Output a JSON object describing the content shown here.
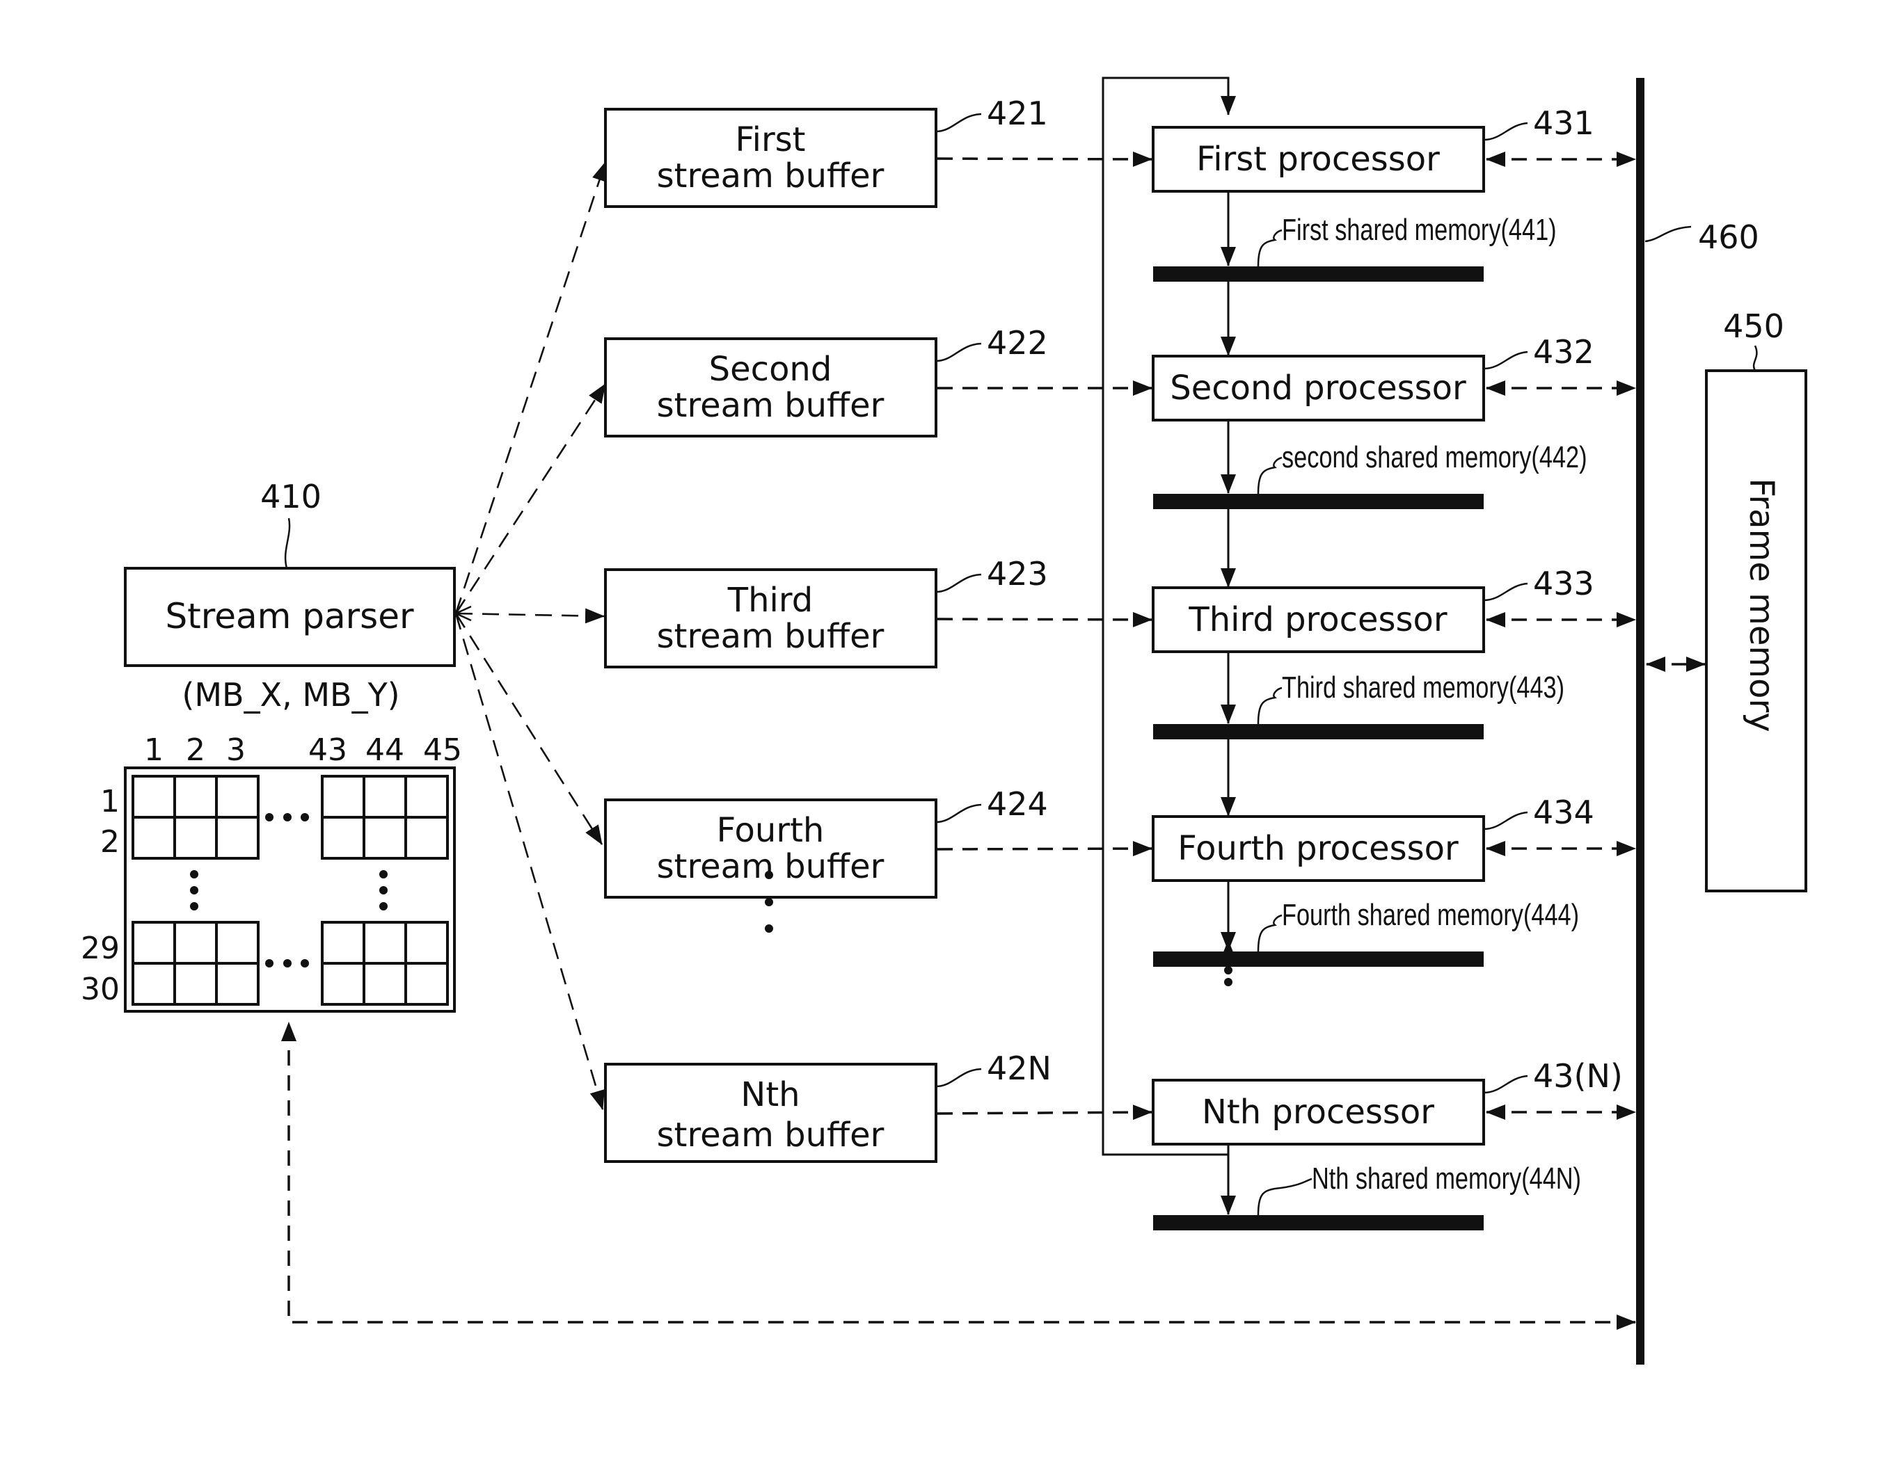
{
  "parser": {
    "label": "Stream parser",
    "ref": "410",
    "coord_label": "(MB_X, MB_Y)",
    "grid": {
      "col_labels": [
        "1",
        "2",
        "3",
        "43",
        "44",
        "45"
      ],
      "row_labels": [
        "1",
        "2",
        "29",
        "30"
      ],
      "ellipsis": "…"
    }
  },
  "buffers": [
    {
      "line1": "First",
      "line2": "stream buffer",
      "ref": "421"
    },
    {
      "line1": "Second",
      "line2": "stream buffer",
      "ref": "422"
    },
    {
      "line1": "Third",
      "line2": "stream buffer",
      "ref": "423"
    },
    {
      "line1": "Fourth",
      "line2": "stream buffer",
      "ref": "424"
    },
    {
      "line1": "Nth",
      "line2": "stream buffer",
      "ref": "42N"
    }
  ],
  "processors": [
    {
      "label": "First processor",
      "ref": "431",
      "memory": "First shared memory(441)"
    },
    {
      "label": "Second processor",
      "ref": "432",
      "memory": "second shared memory(442)"
    },
    {
      "label": "Third processor",
      "ref": "433",
      "memory": "Third shared memory(443)"
    },
    {
      "label": "Fourth processor",
      "ref": "434",
      "memory": "Fourth shared memory(444)"
    },
    {
      "label": "Nth processor",
      "ref": "43(N)",
      "memory": "Nth shared memory(44N)"
    }
  ],
  "bus": {
    "ref": "460"
  },
  "frame_memory": {
    "label": "Frame memory",
    "ref": "450"
  }
}
